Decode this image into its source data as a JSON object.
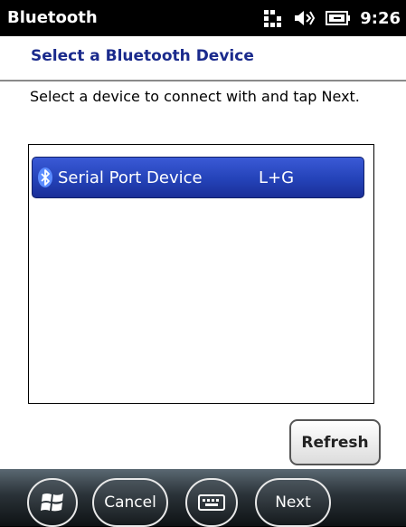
{
  "statusbar": {
    "app_title": "Bluetooth",
    "clock": "9:26",
    "icons": [
      "data-connection-icon",
      "speaker-icon",
      "battery-icon"
    ]
  },
  "header": {
    "title": "Select a Bluetooth Device"
  },
  "main": {
    "instructions": "Select a device to connect with and tap Next.",
    "devices": [
      {
        "name": "Serial Port Device",
        "address": "L+G",
        "icon": "bluetooth-icon",
        "selected": true
      }
    ],
    "refresh_label": "Refresh"
  },
  "bottombar": {
    "start_icon": "windows-start-icon",
    "cancel_label": "Cancel",
    "keyboard_icon": "keyboard-icon",
    "next_label": "Next"
  },
  "colors": {
    "header_text": "#1a2a8c",
    "selection": "#2442b8",
    "statusbar_bg": "#000000"
  }
}
